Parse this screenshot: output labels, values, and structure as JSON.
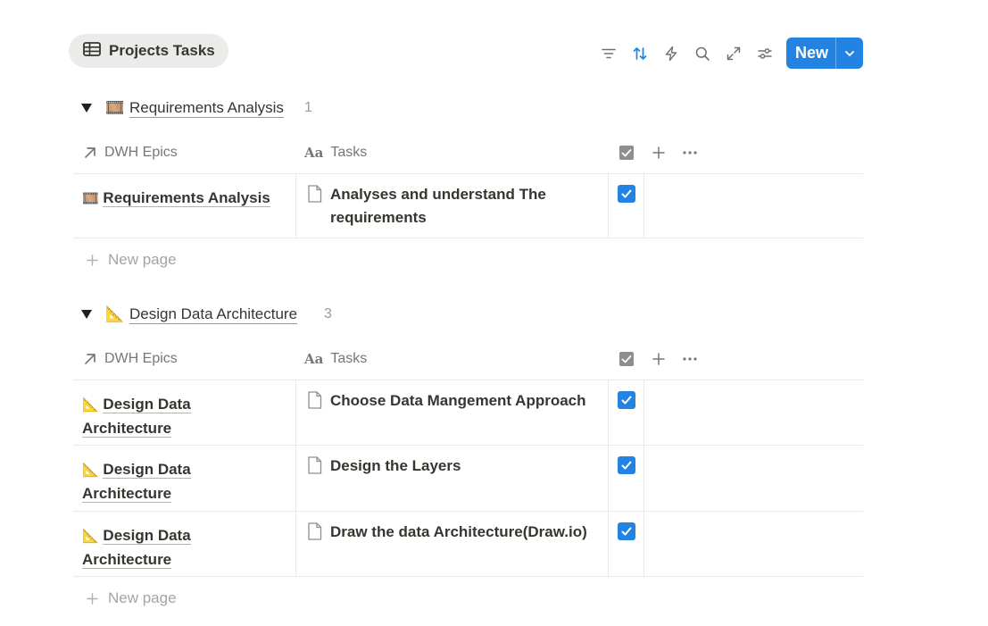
{
  "view": {
    "title": "Projects Tasks",
    "icon": "table-icon"
  },
  "toolbar": {
    "icons": [
      "filter-icon",
      "sort-icon",
      "automation-icon",
      "search-icon",
      "expand-icon",
      "settings-icon"
    ],
    "new_label": "New",
    "accent": "#2383e2"
  },
  "columns": {
    "epics": "DWH Epics",
    "tasks": "Tasks",
    "tasks_prefix": "Aa"
  },
  "new_page_label": "New page",
  "groups": [
    {
      "emoji": "🎞️",
      "title": "Requirements Analysis",
      "count": "1",
      "rows": [
        {
          "epic": "Requirements Analysis",
          "task": "Analyses and understand The requirements",
          "done": true
        }
      ]
    },
    {
      "emoji": "📐",
      "title": "Design Data Architecture",
      "count": "3",
      "rows": [
        {
          "epic": "Design Data Architecture",
          "task": "Choose Data Mangement Approach",
          "done": true
        },
        {
          "epic": "Design Data Architecture",
          "task": "Design the Layers",
          "done": true
        },
        {
          "epic": "Design Data Architecture",
          "task": "Draw the data Architecture(Draw.io)",
          "done": true
        }
      ]
    }
  ]
}
